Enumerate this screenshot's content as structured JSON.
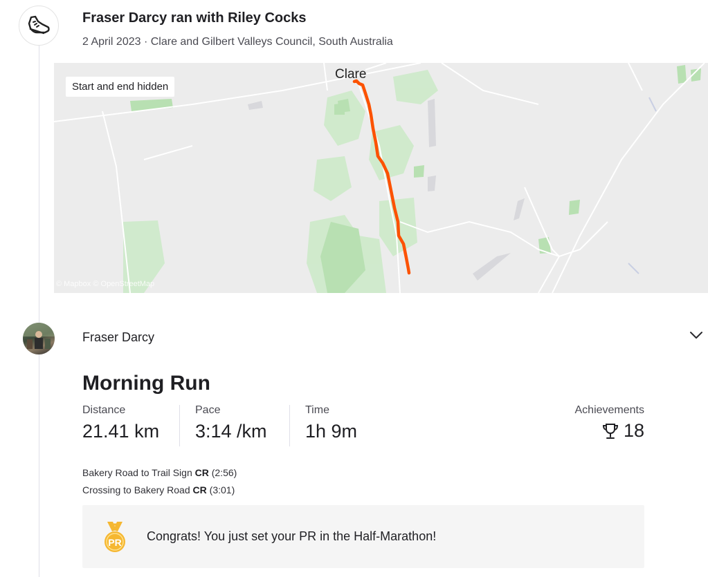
{
  "group": {
    "title": "Fraser Darcy ran with Riley Cocks",
    "meta": "2 April 2023 · Clare and Gilbert Valleys Council, South Australia"
  },
  "map": {
    "badge": "Start and end hidden",
    "town_label": "Clare",
    "attribution": "© Mapbox © OpenStreetMap",
    "route_color": "#fc5200"
  },
  "activity": {
    "athlete_name": "Fraser Darcy",
    "title": "Morning Run",
    "stats": [
      {
        "label": "Distance",
        "value": "21.41 km"
      },
      {
        "label": "Pace",
        "value": "3:14 /km"
      },
      {
        "label": "Time",
        "value": "1h 9m"
      }
    ],
    "achievements": {
      "label": "Achievements",
      "count": "18"
    },
    "segments": [
      {
        "name": "Bakery Road to Trail Sign",
        "badge": "CR",
        "time": "(2:56)"
      },
      {
        "name": "Crossing to Bakery Road",
        "badge": "CR",
        "time": "(3:01)"
      }
    ],
    "pr_message": {
      "medal_text": "PR",
      "text": "Congrats! You just set your PR in the Half-Marathon!"
    }
  },
  "icons": {
    "activity": "running-shoe-icon",
    "expand": "chevron-down-icon",
    "achievements": "trophy-icon",
    "pr": "medal-icon"
  },
  "colors": {
    "accent": "#fc5200",
    "medal": "#f5b731"
  }
}
